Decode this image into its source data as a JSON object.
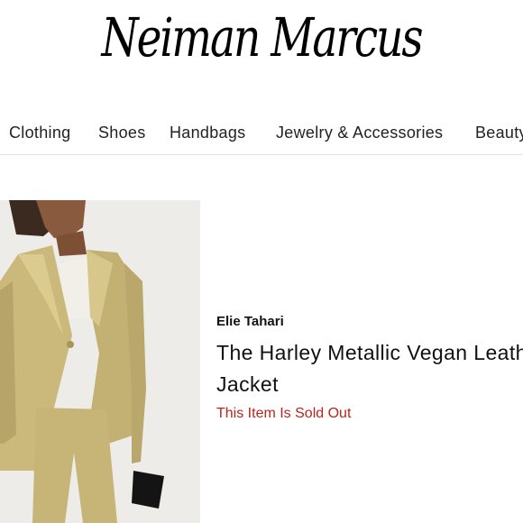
{
  "header": {
    "logo_text": "Neiman Marcus"
  },
  "nav": {
    "items": [
      {
        "label": "Clothing"
      },
      {
        "label": "Shoes"
      },
      {
        "label": "Handbags"
      },
      {
        "label": "Jewelry & Accessories"
      },
      {
        "label": "Beauty"
      }
    ]
  },
  "product": {
    "brand": "Elie Tahari",
    "title": "The Harley Metallic Vegan Leather Jacket",
    "status": "This Item Is Sold Out",
    "status_color": "#b5261e",
    "jacket_color": "#cbb97c"
  }
}
